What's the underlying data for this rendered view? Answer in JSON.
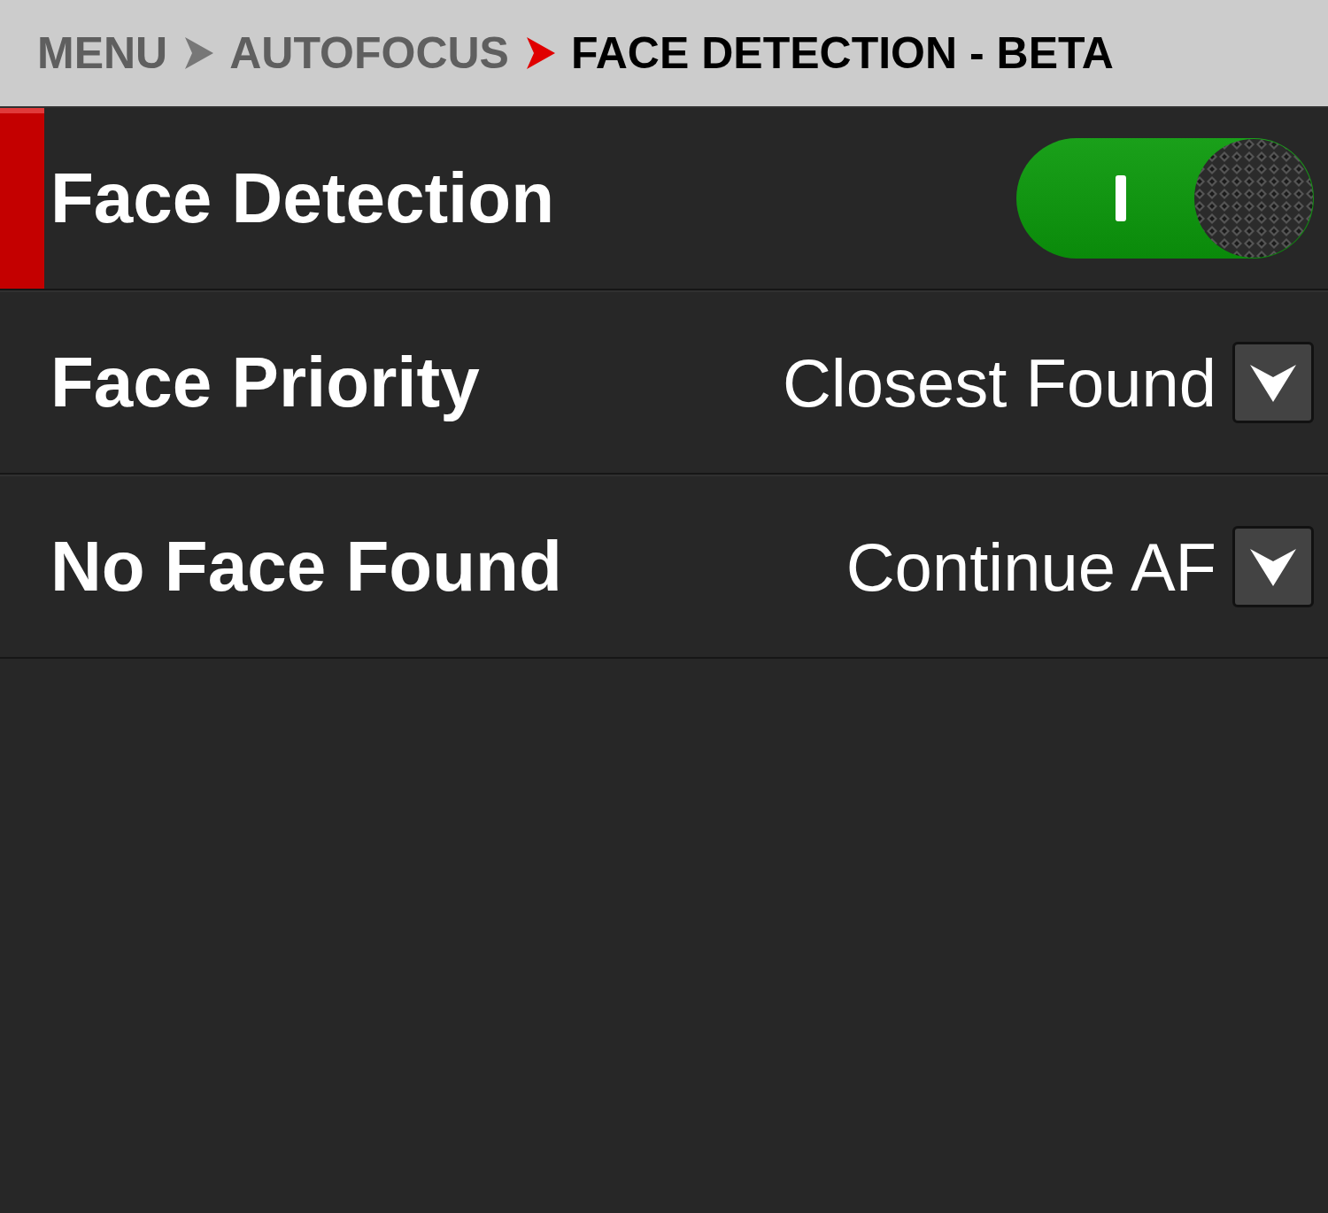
{
  "breadcrumb": [
    {
      "label": "MENU",
      "current": false
    },
    {
      "label": "AUTOFOCUS",
      "current": false
    },
    {
      "label": "FACE DETECTION - BETA",
      "current": true
    }
  ],
  "settings": [
    {
      "kind": "toggle",
      "label": "Face Detection",
      "selected": true,
      "on": true
    },
    {
      "kind": "dropdown",
      "label": "Face Priority",
      "selected": false,
      "value": "Closest Found"
    },
    {
      "kind": "dropdown",
      "label": "No Face Found",
      "selected": false,
      "value": "Continue AF"
    }
  ]
}
